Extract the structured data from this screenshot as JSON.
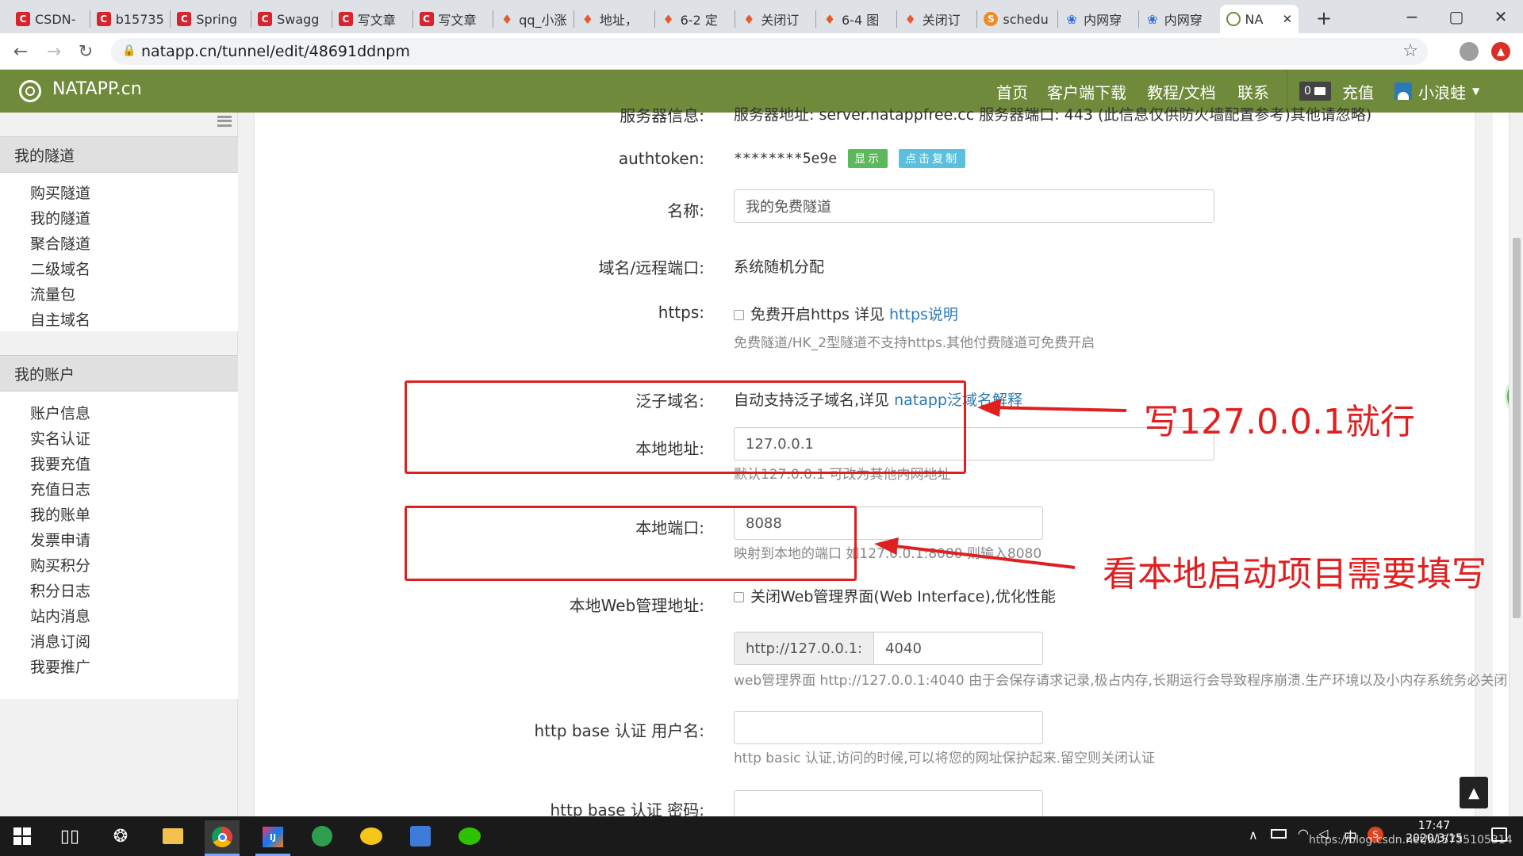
{
  "browser": {
    "tabs": [
      {
        "label": "CSDN-",
        "icon_color": "#d9232d",
        "icon": "C"
      },
      {
        "label": "b15735",
        "icon_color": "#d9232d",
        "icon": "C"
      },
      {
        "label": "Spring",
        "icon_color": "#d9232d",
        "icon": "C"
      },
      {
        "label": "Swagg",
        "icon_color": "#d9232d",
        "icon": "C"
      },
      {
        "label": "写文章",
        "icon_color": "#d9232d",
        "icon": "C"
      },
      {
        "label": "写文章",
        "icon_color": "#d9232d",
        "icon": "C"
      },
      {
        "label": "qq_小涨",
        "icon_color": "#e85a2a",
        "icon": "flame"
      },
      {
        "label": "地址，",
        "icon_color": "#e85a2a",
        "icon": "flame"
      },
      {
        "label": "6-2 定",
        "icon_color": "#e85a2a",
        "icon": "flame"
      },
      {
        "label": "关闭订",
        "icon_color": "#e85a2a",
        "icon": "flame"
      },
      {
        "label": "6-4 图",
        "icon_color": "#e85a2a",
        "icon": "flame"
      },
      {
        "label": "关闭订",
        "icon_color": "#e85a2a",
        "icon": "flame"
      },
      {
        "label": "schedu",
        "icon_color": "#f08a24",
        "icon": "S"
      },
      {
        "label": "内网穿",
        "icon_color": "#2d6be0",
        "icon": "paw"
      },
      {
        "label": "内网穿",
        "icon_color": "#2d6be0",
        "icon": "paw"
      },
      {
        "label": "NA",
        "icon_color": "#6f8a3b",
        "icon": "natapp",
        "active": true
      }
    ],
    "new_tab": "+",
    "url": "natapp.cn/tunnel/edit/48691ddnpm"
  },
  "site": {
    "logo_text": "NATAPP.cn",
    "nav": [
      "首页",
      "客户端下载",
      "教程/文档",
      "联系"
    ],
    "balance_badge": "0",
    "recharge": "充值",
    "username": "小浪蛙",
    "colors": {
      "header": "#6f8a3b",
      "link": "#2a7ab8",
      "green_btn": "#5cb85c",
      "blue_btn": "#5bc0de",
      "annotation": "#e02020"
    }
  },
  "sidebar": {
    "section1_title": "我的隧道",
    "section1_items": [
      "购买隧道",
      "我的隧道",
      "聚合隧道",
      "二级域名",
      "流量包",
      "自主域名"
    ],
    "section2_title": "我的账户",
    "section2_items": [
      "账户信息",
      "实名认证",
      "我要充值",
      "充值日志",
      "我的账单",
      "发票申请",
      "购买积分",
      "积分日志",
      "站内消息",
      "消息订阅",
      "我要推广"
    ]
  },
  "form": {
    "server_label_partial": "服务器信息:",
    "server_value_partial": "服务器地址: server.natappfree.cc 服务器端口: 443 (此信息仅供防火墙配置参考)其他请忽略)",
    "authtoken_label": "authtoken:",
    "authtoken_value": "********5e9e",
    "show_btn": "显示",
    "copy_btn": "点击复制",
    "name_label": "名称:",
    "name_value": "我的免费隧道",
    "domain_label": "域名/远程端口:",
    "domain_value": "系统随机分配",
    "https_label": "https:",
    "https_checkbox": "免费开启https 详见",
    "https_link": "https说明",
    "https_help": "免费隧道/HK_2型隧道不支持https.其他付费隧道可免费开启",
    "wildcard_label": "泛子域名:",
    "wildcard_value": "自动支持泛子域名,详见",
    "wildcard_link": "natapp泛域名解释",
    "local_addr_label": "本地地址:",
    "local_addr_value": "127.0.0.1",
    "local_addr_help": "默认127.0.0.1 可改为其他内网地址",
    "local_port_label": "本地端口:",
    "local_port_value": "8088",
    "local_port_help": "映射到本地的端口 如127.0.0.1:8080 则输入8080",
    "web_label": "本地Web管理地址:",
    "web_checkbox": "关闭Web管理界面(Web Interface),优化性能",
    "web_prefix": "http://127.0.0.1:",
    "web_port": "4040",
    "web_help": "web管理界面 http://127.0.0.1:4040 由于会保存请求记录,极占内存,长期运行会导致程序崩溃.生产环境以及小内存系统务必关闭",
    "basic_user_label": "http base 认证 用户名:",
    "basic_user_value": "",
    "basic_help": "http basic 认证,访问的时候,可以将您的网址保护起来.留空则关闭认证",
    "basic_pass_label": "http base 认证 密码:"
  },
  "annotations": {
    "note1": "写127.0.0.1就行",
    "note2": "看本地启动项目需要填写"
  },
  "taskbar": {
    "time": "17:47",
    "date": "2020/3/15",
    "ime": "中",
    "watermark": "https://blog.csdn.net/b15735105314"
  }
}
